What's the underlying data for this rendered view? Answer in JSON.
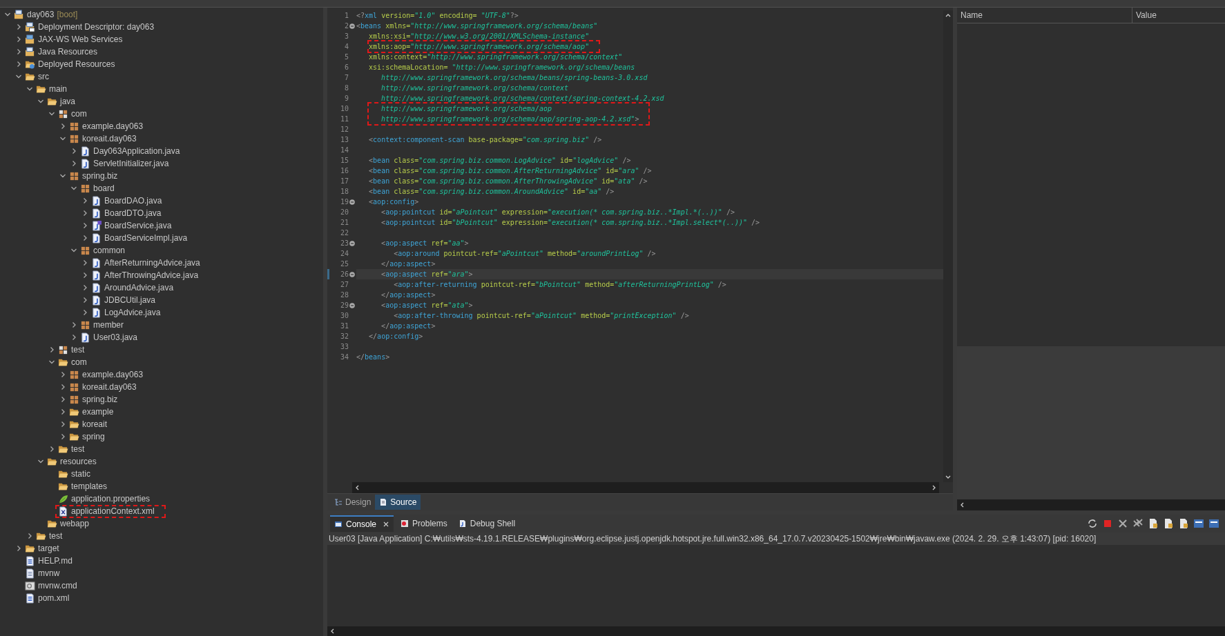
{
  "explorer": {
    "items": [
      {
        "label": "day063",
        "decoration": "[boot]",
        "kind": "project",
        "expanded": true,
        "children": [
          {
            "label": "Deployment Descriptor: day063",
            "kind": "descriptor",
            "expanded": false
          },
          {
            "label": "JAX-WS Web Services",
            "kind": "services",
            "expanded": false
          },
          {
            "label": "Java Resources",
            "kind": "resources",
            "expanded": false
          },
          {
            "label": "Deployed Resources",
            "kind": "deployed",
            "expanded": false
          },
          {
            "label": "src",
            "kind": "folder",
            "expanded": true,
            "children": [
              {
                "label": "main",
                "kind": "folder",
                "expanded": true,
                "children": [
                  {
                    "label": "java",
                    "kind": "folder",
                    "expanded": true,
                    "children": [
                      {
                        "label": "com",
                        "kind": "package-root",
                        "expanded": true,
                        "children": [
                          {
                            "label": "example.day063",
                            "kind": "package",
                            "expanded": false
                          },
                          {
                            "label": "koreait.day063",
                            "kind": "package",
                            "expanded": true,
                            "children": [
                              {
                                "label": "Day063Application.java",
                                "kind": "java",
                                "expanded": false
                              },
                              {
                                "label": "ServletInitializer.java",
                                "kind": "java",
                                "expanded": false
                              }
                            ]
                          },
                          {
                            "label": "spring.biz",
                            "kind": "package",
                            "expanded": true,
                            "children": [
                              {
                                "label": "board",
                                "kind": "package",
                                "expanded": true,
                                "children": [
                                  {
                                    "label": "BoardDAO.java",
                                    "kind": "java",
                                    "expanded": false
                                  },
                                  {
                                    "label": "BoardDTO.java",
                                    "kind": "java",
                                    "expanded": false
                                  },
                                  {
                                    "label": "BoardService.java",
                                    "kind": "interface",
                                    "expanded": false
                                  },
                                  {
                                    "label": "BoardServiceImpl.java",
                                    "kind": "java",
                                    "expanded": false
                                  }
                                ]
                              },
                              {
                                "label": "common",
                                "kind": "package",
                                "expanded": true,
                                "children": [
                                  {
                                    "label": "AfterReturningAdvice.java",
                                    "kind": "java",
                                    "expanded": false
                                  },
                                  {
                                    "label": "AfterThrowingAdvice.java",
                                    "kind": "java",
                                    "expanded": false
                                  },
                                  {
                                    "label": "AroundAdvice.java",
                                    "kind": "java",
                                    "expanded": false
                                  },
                                  {
                                    "label": "JDBCUtil.java",
                                    "kind": "java",
                                    "expanded": false
                                  },
                                  {
                                    "label": "LogAdvice.java",
                                    "kind": "java",
                                    "expanded": false
                                  }
                                ]
                              },
                              {
                                "label": "member",
                                "kind": "package",
                                "expanded": false
                              },
                              {
                                "label": "User03.java",
                                "kind": "java",
                                "expanded": false
                              }
                            ]
                          }
                        ]
                      },
                      {
                        "label": "test",
                        "kind": "package-root",
                        "expanded": false
                      },
                      {
                        "label": "com",
                        "kind": "folder",
                        "expanded": true,
                        "children": [
                          {
                            "label": "example.day063",
                            "kind": "package",
                            "expanded": false
                          },
                          {
                            "label": "koreait.day063",
                            "kind": "package",
                            "expanded": false
                          },
                          {
                            "label": "spring.biz",
                            "kind": "package",
                            "expanded": false
                          },
                          {
                            "label": "example",
                            "kind": "folder",
                            "expanded": false
                          },
                          {
                            "label": "koreait",
                            "kind": "folder",
                            "expanded": false
                          },
                          {
                            "label": "spring",
                            "kind": "folder",
                            "expanded": false
                          }
                        ]
                      },
                      {
                        "label": "test",
                        "kind": "folder",
                        "expanded": false
                      }
                    ]
                  },
                  {
                    "label": "resources",
                    "kind": "folder",
                    "expanded": true,
                    "children": [
                      {
                        "label": "static",
                        "kind": "folder"
                      },
                      {
                        "label": "templates",
                        "kind": "folder"
                      },
                      {
                        "label": "application.properties",
                        "kind": "properties"
                      },
                      {
                        "label": "applicationContext.xml",
                        "kind": "xml",
                        "marked": true
                      }
                    ]
                  },
                  {
                    "label": "webapp",
                    "kind": "folder"
                  }
                ]
              },
              {
                "label": "test",
                "kind": "folder",
                "expanded": false
              }
            ]
          },
          {
            "label": "target",
            "kind": "folder",
            "expanded": false
          },
          {
            "label": "HELP.md",
            "kind": "md"
          },
          {
            "label": "mvnw",
            "kind": "text"
          },
          {
            "label": "mvnw.cmd",
            "kind": "cmd"
          },
          {
            "label": "pom.xml",
            "kind": "maven"
          }
        ]
      }
    ]
  },
  "editor": {
    "lines": [
      {
        "number": "1",
        "tokens": [
          {
            "kind": "bracket",
            "text": "<?"
          },
          {
            "kind": "tag",
            "text": "xml"
          },
          {
            "kind": "attr",
            "text": " version="
          },
          {
            "kind": "value",
            "text": "\"1.0\""
          },
          {
            "kind": "attr",
            "text": " encoding= "
          },
          {
            "kind": "value",
            "text": "\"UTF-8\""
          },
          {
            "kind": "bracket",
            "text": "?>"
          }
        ]
      },
      {
        "number": "2",
        "fold": true,
        "tokens": [
          {
            "kind": "bracket",
            "text": "<"
          },
          {
            "kind": "tag",
            "text": "beans"
          },
          {
            "kind": "attr",
            "text": " xmlns="
          },
          {
            "kind": "value",
            "text": "\"http://www.springframework.org/schema/beans\""
          }
        ]
      },
      {
        "number": "3",
        "tokens": [
          {
            "kind": "attr",
            "text": "   xmlns:xsi="
          },
          {
            "kind": "value",
            "text": "\"http://www.w3.org/2001/XMLSchema-instance\""
          }
        ]
      },
      {
        "number": "4",
        "marked": true,
        "tokens": [
          {
            "kind": "attr",
            "text": "   xmlns:aop="
          },
          {
            "kind": "value",
            "text": "\"http://www.springframework.org/schema/aop\""
          }
        ]
      },
      {
        "number": "5",
        "tokens": [
          {
            "kind": "attr",
            "text": "   xmlns:context="
          },
          {
            "kind": "value",
            "text": "\"http://www.springframework.org/schema/context\""
          }
        ]
      },
      {
        "number": "6",
        "tokens": [
          {
            "kind": "attr",
            "text": "   xsi:schemaLocation= "
          },
          {
            "kind": "value",
            "text": "\"http://www.springframework.org/schema/beans"
          }
        ]
      },
      {
        "number": "7",
        "tokens": [
          {
            "kind": "value",
            "text": "      http://www.springframework.org/schema/beans/spring-beans-3.0.xsd"
          }
        ]
      },
      {
        "number": "8",
        "tokens": [
          {
            "kind": "value",
            "text": "      http://www.springframework.org/schema/context"
          }
        ]
      },
      {
        "number": "9",
        "tokens": [
          {
            "kind": "value",
            "text": "      http://www.springframework.org/schema/context/spring-context-4.2.xsd"
          }
        ]
      },
      {
        "number": "10",
        "marked": true,
        "tokens": [
          {
            "kind": "value",
            "text": "      http://www.springframework.org/schema/aop"
          }
        ]
      },
      {
        "number": "11",
        "marked": true,
        "tokens": [
          {
            "kind": "value",
            "text": "      http://www.springframework.org/schema/aop/spring-aop-4.2.xsd\""
          },
          {
            "kind": "bracket",
            "text": ">"
          }
        ]
      },
      {
        "number": "12"
      },
      {
        "number": "13",
        "tokens": [
          {
            "kind": "bracket",
            "text": "   <"
          },
          {
            "kind": "tag",
            "text": "context:component-scan"
          },
          {
            "kind": "attr",
            "text": " base-package="
          },
          {
            "kind": "value",
            "text": "\"com.spring.biz\""
          },
          {
            "kind": "bracket",
            "text": " />"
          }
        ]
      },
      {
        "number": "14"
      },
      {
        "number": "15",
        "tokens": [
          {
            "kind": "bracket",
            "text": "   <"
          },
          {
            "kind": "tag",
            "text": "bean"
          },
          {
            "kind": "attr",
            "text": " class="
          },
          {
            "kind": "value",
            "text": "\"com.spring.biz.common.LogAdvice\""
          },
          {
            "kind": "attr",
            "text": " id="
          },
          {
            "kind": "value",
            "text": "\"logAdvice\""
          },
          {
            "kind": "bracket",
            "text": " />"
          }
        ]
      },
      {
        "number": "16",
        "tokens": [
          {
            "kind": "bracket",
            "text": "   <"
          },
          {
            "kind": "tag",
            "text": "bean"
          },
          {
            "kind": "attr",
            "text": " class="
          },
          {
            "kind": "value",
            "text": "\"com.spring.biz.common.AfterReturningAdvice\""
          },
          {
            "kind": "attr",
            "text": " id="
          },
          {
            "kind": "value",
            "text": "\"ara\""
          },
          {
            "kind": "bracket",
            "text": " />"
          }
        ]
      },
      {
        "number": "17",
        "tokens": [
          {
            "kind": "bracket",
            "text": "   <"
          },
          {
            "kind": "tag",
            "text": "bean"
          },
          {
            "kind": "attr",
            "text": " class="
          },
          {
            "kind": "value",
            "text": "\"com.spring.biz.common.AfterThrowingAdvice\""
          },
          {
            "kind": "attr",
            "text": " id="
          },
          {
            "kind": "value",
            "text": "\"ata\""
          },
          {
            "kind": "bracket",
            "text": " />"
          }
        ]
      },
      {
        "number": "18",
        "tokens": [
          {
            "kind": "bracket",
            "text": "   <"
          },
          {
            "kind": "tag",
            "text": "bean"
          },
          {
            "kind": "attr",
            "text": " class="
          },
          {
            "kind": "value",
            "text": "\"com.spring.biz.common.AroundAdvice\""
          },
          {
            "kind": "attr",
            "text": " id="
          },
          {
            "kind": "value",
            "text": "\"aa\""
          },
          {
            "kind": "bracket",
            "text": " />"
          }
        ]
      },
      {
        "number": "19",
        "fold": true,
        "tokens": [
          {
            "kind": "bracket",
            "text": "   <"
          },
          {
            "kind": "tag",
            "text": "aop:config"
          },
          {
            "kind": "bracket",
            "text": ">"
          }
        ]
      },
      {
        "number": "20",
        "tokens": [
          {
            "kind": "bracket",
            "text": "      <"
          },
          {
            "kind": "tag",
            "text": "aop:pointcut"
          },
          {
            "kind": "attr",
            "text": " id="
          },
          {
            "kind": "value",
            "text": "\"aPointcut\""
          },
          {
            "kind": "attr",
            "text": " expression="
          },
          {
            "kind": "value",
            "text": "\"execution(* com.spring.biz..*Impl.*(..))\""
          },
          {
            "kind": "bracket",
            "text": " />"
          }
        ]
      },
      {
        "number": "21",
        "tokens": [
          {
            "kind": "bracket",
            "text": "      <"
          },
          {
            "kind": "tag",
            "text": "aop:pointcut"
          },
          {
            "kind": "attr",
            "text": " id="
          },
          {
            "kind": "value",
            "text": "\"bPointcut\""
          },
          {
            "kind": "attr",
            "text": " expression="
          },
          {
            "kind": "value",
            "text": "\"execution(* com.spring.biz..*Impl.select*(..))\""
          },
          {
            "kind": "bracket",
            "text": " />"
          }
        ]
      },
      {
        "number": "22"
      },
      {
        "number": "23",
        "fold": true,
        "tokens": [
          {
            "kind": "bracket",
            "text": "      <"
          },
          {
            "kind": "tag",
            "text": "aop:aspect"
          },
          {
            "kind": "attr",
            "text": " ref="
          },
          {
            "kind": "value",
            "text": "\"aa\""
          },
          {
            "kind": "bracket",
            "text": ">"
          }
        ]
      },
      {
        "number": "24",
        "tokens": [
          {
            "kind": "bracket",
            "text": "         <"
          },
          {
            "kind": "tag",
            "text": "aop:around"
          },
          {
            "kind": "attr",
            "text": " pointcut-ref="
          },
          {
            "kind": "value",
            "text": "\"aPointcut\""
          },
          {
            "kind": "attr",
            "text": " method="
          },
          {
            "kind": "value",
            "text": "\"aroundPrintLog\""
          },
          {
            "kind": "bracket",
            "text": " />"
          }
        ]
      },
      {
        "number": "25",
        "tokens": [
          {
            "kind": "bracket",
            "text": "      </"
          },
          {
            "kind": "tag",
            "text": "aop:aspect"
          },
          {
            "kind": "bracket",
            "text": ">"
          }
        ]
      },
      {
        "number": "26",
        "fold": true,
        "current": true,
        "tokens": [
          {
            "kind": "bracket",
            "text": "      <"
          },
          {
            "kind": "tag",
            "text": "aop:aspect"
          },
          {
            "kind": "attr",
            "text": " ref="
          },
          {
            "kind": "value",
            "text": "\"ara\""
          },
          {
            "kind": "bracket",
            "text": ">"
          }
        ]
      },
      {
        "number": "27",
        "tokens": [
          {
            "kind": "bracket",
            "text": "         <"
          },
          {
            "kind": "tag",
            "text": "aop:after-returning"
          },
          {
            "kind": "attr",
            "text": " pointcut-ref="
          },
          {
            "kind": "value",
            "text": "\"bPointcut\""
          },
          {
            "kind": "attr",
            "text": " method="
          },
          {
            "kind": "value",
            "text": "\"afterReturningPrintLog\""
          },
          {
            "kind": "bracket",
            "text": " />"
          }
        ]
      },
      {
        "number": "28",
        "tokens": [
          {
            "kind": "bracket",
            "text": "      </"
          },
          {
            "kind": "tag",
            "text": "aop:aspect"
          },
          {
            "kind": "bracket",
            "text": ">"
          }
        ]
      },
      {
        "number": "29",
        "fold": true,
        "tokens": [
          {
            "kind": "bracket",
            "text": "      <"
          },
          {
            "kind": "tag",
            "text": "aop:aspect"
          },
          {
            "kind": "attr",
            "text": " ref="
          },
          {
            "kind": "value",
            "text": "\"ata\""
          },
          {
            "kind": "bracket",
            "text": ">"
          }
        ]
      },
      {
        "number": "30",
        "tokens": [
          {
            "kind": "bracket",
            "text": "         <"
          },
          {
            "kind": "tag",
            "text": "aop:after-throwing"
          },
          {
            "kind": "attr",
            "text": " pointcut-ref="
          },
          {
            "kind": "value",
            "text": "\"aPointcut\""
          },
          {
            "kind": "attr",
            "text": " method="
          },
          {
            "kind": "value",
            "text": "\"printException\""
          },
          {
            "kind": "bracket",
            "text": " />"
          }
        ]
      },
      {
        "number": "31",
        "tokens": [
          {
            "kind": "bracket",
            "text": "      </"
          },
          {
            "kind": "tag",
            "text": "aop:aspect"
          },
          {
            "kind": "bracket",
            "text": ">"
          }
        ]
      },
      {
        "number": "32",
        "tokens": [
          {
            "kind": "bracket",
            "text": "   </"
          },
          {
            "kind": "tag",
            "text": "aop:config"
          },
          {
            "kind": "bracket",
            "text": ">"
          }
        ]
      },
      {
        "number": "33"
      },
      {
        "number": "34",
        "tokens": [
          {
            "kind": "bracket",
            "text": "</"
          },
          {
            "kind": "tag",
            "text": "beans"
          },
          {
            "kind": "bracket",
            "text": ">"
          }
        ]
      }
    ],
    "tabs": [
      {
        "label": "Design",
        "kind": "design",
        "selected": false
      },
      {
        "label": "Source",
        "kind": "source",
        "selected": true
      }
    ]
  },
  "variables": {
    "columns": [
      "Name",
      "Value"
    ]
  },
  "console": {
    "tabs": [
      {
        "label": "Console",
        "kind": "console",
        "selected": true
      },
      {
        "label": "Problems",
        "kind": "problems",
        "selected": false
      },
      {
        "label": "Debug Shell",
        "kind": "shell",
        "selected": false
      }
    ],
    "header": "User03 [Java Application] C:₩utils₩sts-4.19.1.RELEASE₩plugins₩org.eclipse.justj.openjdk.hotspot.jre.full.win32.x86_64_17.0.7.v20230425-1502₩jre₩bin₩javaw.exe  (2024. 2. 29. 오후 1:43:07) [pid: 16020]"
  }
}
